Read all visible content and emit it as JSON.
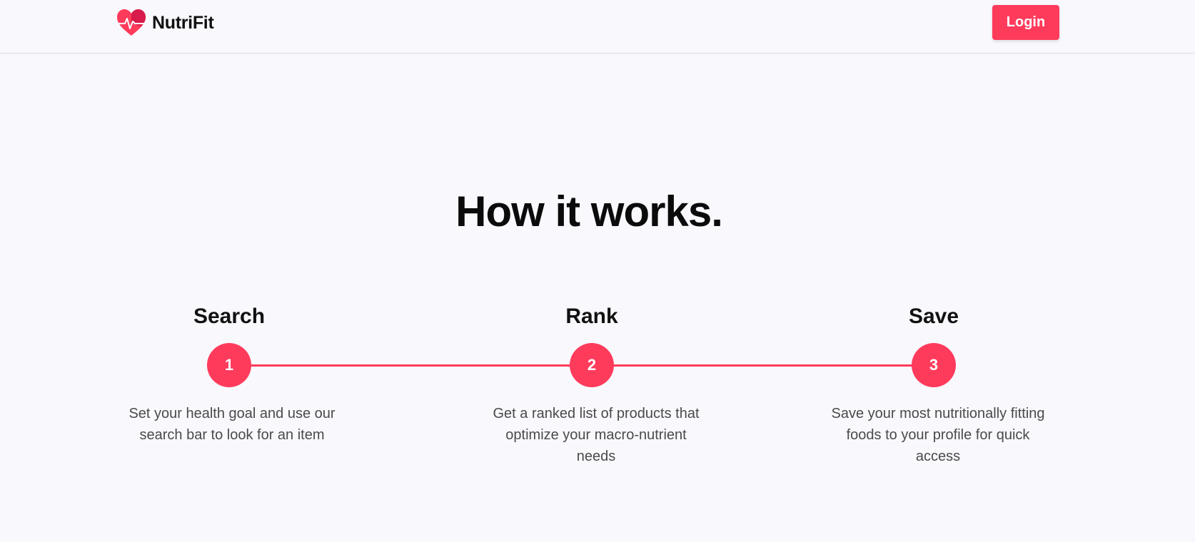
{
  "brand": {
    "name": "NutriFit",
    "logo_icon": "heart-pulse-icon"
  },
  "nav": {
    "login_label": "Login"
  },
  "section": {
    "title": "How it works."
  },
  "steps": [
    {
      "number": "1",
      "title": "Search",
      "description": "Set your health goal and use our search bar to look for an item"
    },
    {
      "number": "2",
      "title": "Rank",
      "description": "Get a ranked list of products that optimize your macro-nutrient needs"
    },
    {
      "number": "3",
      "title": "Save",
      "description": "Save your most nutritionally fitting foods to your profile for quick access"
    }
  ],
  "colors": {
    "accent": "#ff3b5c",
    "heart_dark": "#d81b4a",
    "background": "#f8f8fd"
  }
}
